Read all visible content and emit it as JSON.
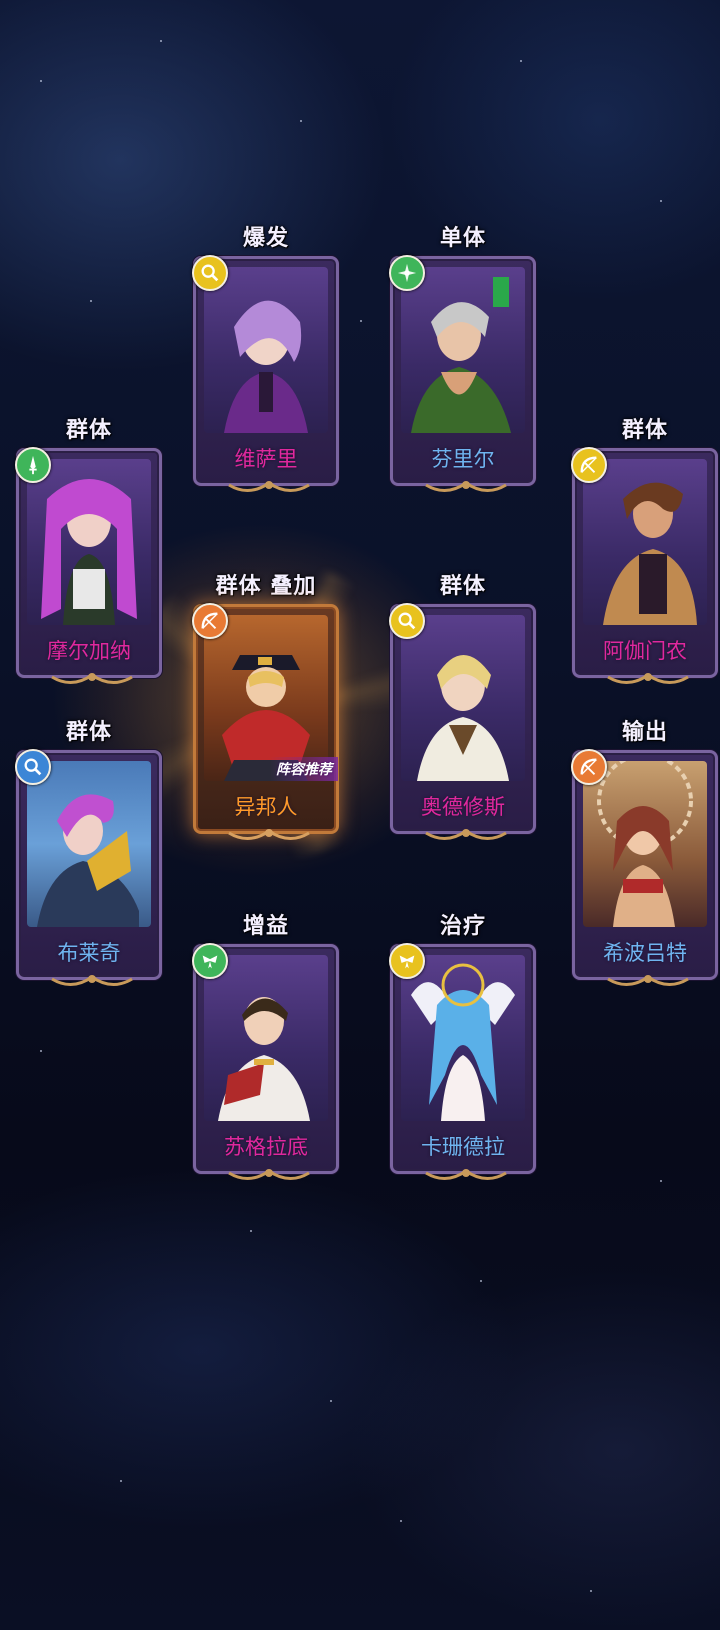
{
  "heroes": [
    {
      "id": "weisali",
      "name": "维萨里",
      "role": "爆发",
      "badge": "magnifier-icon",
      "badge_color": "#e8c21e",
      "name_color": "#e0289e"
    },
    {
      "id": "fenlier",
      "name": "芬里尔",
      "role": "单体",
      "badge": "shuriken-icon",
      "badge_color": "#3fb55a",
      "name_color": "#6fb4f0"
    },
    {
      "id": "moerjiana",
      "name": "摩尔加纳",
      "role": "群体",
      "badge": "dagger-icon",
      "badge_color": "#3fb55a",
      "name_color": "#e0289e"
    },
    {
      "id": "agamennon",
      "name": "阿伽门农",
      "role": "群体",
      "badge": "bow-icon",
      "badge_color": "#e8c21e",
      "name_color": "#e0289e"
    },
    {
      "id": "yibangren",
      "name": "异邦人",
      "role": "群体  叠加",
      "badge": "bow-icon",
      "badge_color": "#e87a34",
      "name_color": "#ff9a2a",
      "tag": "阵容推荐"
    },
    {
      "id": "aodexiusi",
      "name": "奥德修斯",
      "role": "群体",
      "badge": "magnifier-icon",
      "badge_color": "#e8c21e",
      "name_color": "#e0289e"
    },
    {
      "id": "bulaiqi",
      "name": "布莱奇",
      "role": "群体",
      "badge": "magnifier-icon",
      "badge_color": "#3c86d6",
      "name_color": "#6fb4f0"
    },
    {
      "id": "xibolute",
      "name": "希波吕特",
      "role": "输出",
      "badge": "bow-icon",
      "badge_color": "#e87a34",
      "name_color": "#6fb4f0"
    },
    {
      "id": "sugeladi",
      "name": "苏格拉底",
      "role": "增益",
      "badge": "wings-icon",
      "badge_color": "#3fb55a",
      "name_color": "#e0289e"
    },
    {
      "id": "kashandela",
      "name": "卡珊德拉",
      "role": "治疗",
      "badge": "wings-icon",
      "badge_color": "#e8c21e",
      "name_color": "#6fb4f0"
    }
  ]
}
